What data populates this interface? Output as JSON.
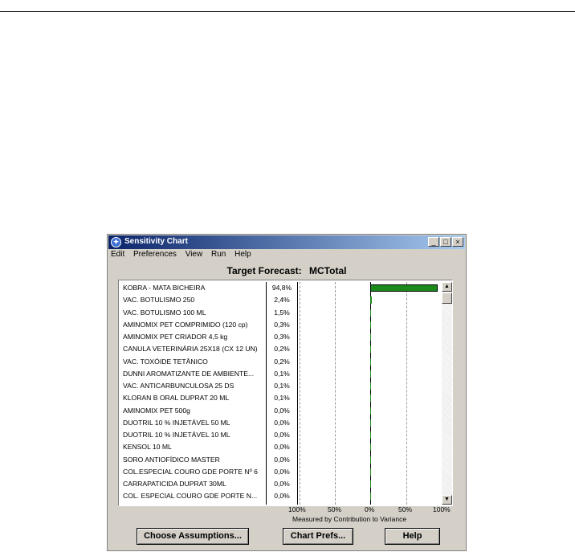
{
  "window": {
    "title": "Sensitivity Chart",
    "controls": {
      "minimize": "_",
      "maximize": "□",
      "close": "×"
    }
  },
  "menu": [
    "Edit",
    "Preferences",
    "View",
    "Run",
    "Help"
  ],
  "target_forecast": {
    "label": "Target Forecast:",
    "value": "MCTotal"
  },
  "rows": [
    {
      "name": "KOBRA - MATA BICHEIRA",
      "pct": "94,8%"
    },
    {
      "name": "VAC. BOTULISMO 250",
      "pct": "2,4%"
    },
    {
      "name": "VAC. BOTULISMO 100 ML",
      "pct": "1,5%"
    },
    {
      "name": "AMINOMIX PET COMPRIMIDO (120 cp)",
      "pct": "0,3%"
    },
    {
      "name": "AMINOMIX PET CRIADOR 4,5 kg",
      "pct": "0,3%"
    },
    {
      "name": "CANULA VETERINÁRIA 25X18 (CX 12 UN)",
      "pct": "0,2%"
    },
    {
      "name": "VAC. TOXÓIDE TETÂNICO",
      "pct": "0,2%"
    },
    {
      "name": "DUNNI AROMATIZANTE DE AMBIENTE...",
      "pct": "0,1%"
    },
    {
      "name": "VAC. ANTICARBUNCULOSA 25 DS",
      "pct": "0,1%"
    },
    {
      "name": "KLORAN B ORAL DUPRAT 20 ML",
      "pct": "0,1%"
    },
    {
      "name": "AMINOMIX PET 500g",
      "pct": "0,0%"
    },
    {
      "name": "DUOTRIL 10 % INJETÁVEL 50 ML",
      "pct": "0,0%"
    },
    {
      "name": "DUOTRIL 10 % INJETÁVEL 10 ML",
      "pct": "0,0%"
    },
    {
      "name": "KENSOL 10 ML",
      "pct": "0,0%"
    },
    {
      "name": "SORO ANTIOFÍDICO MASTER",
      "pct": "0,0%"
    },
    {
      "name": "COL.ESPECIAL COURO GDE PORTE Nº 6",
      "pct": "0,0%"
    },
    {
      "name": "CARRAPATICIDA DUPRAT 30ML",
      "pct": "0,0%"
    },
    {
      "name": "COL. ESPECIAL COURO GDE PORTE N...",
      "pct": "0,0%"
    }
  ],
  "chart_data": {
    "type": "bar",
    "orientation": "horizontal",
    "values": [
      94.8,
      2.4,
      1.5,
      0.3,
      0.3,
      0.2,
      0.2,
      0.1,
      0.1,
      0.1,
      0,
      0,
      0,
      0,
      0,
      0,
      0,
      0
    ],
    "xlim": [
      -100,
      100
    ],
    "x_tick_labels": [
      "100%",
      "50%",
      "0%",
      "50%",
      "100%"
    ],
    "xlabel": "Measured by Contribution to Variance",
    "bar_color": "#1a8a1a"
  },
  "scroll": {
    "up": "▲",
    "down": "▼"
  },
  "buttons": {
    "choose_assumptions": "Choose Assumptions...",
    "chart_prefs": "Chart Prefs...",
    "help": "Help"
  },
  "colors": {
    "titlebar_start": "#0a246a",
    "titlebar_end": "#a6caf0",
    "window_bg": "#d4d0c8"
  }
}
